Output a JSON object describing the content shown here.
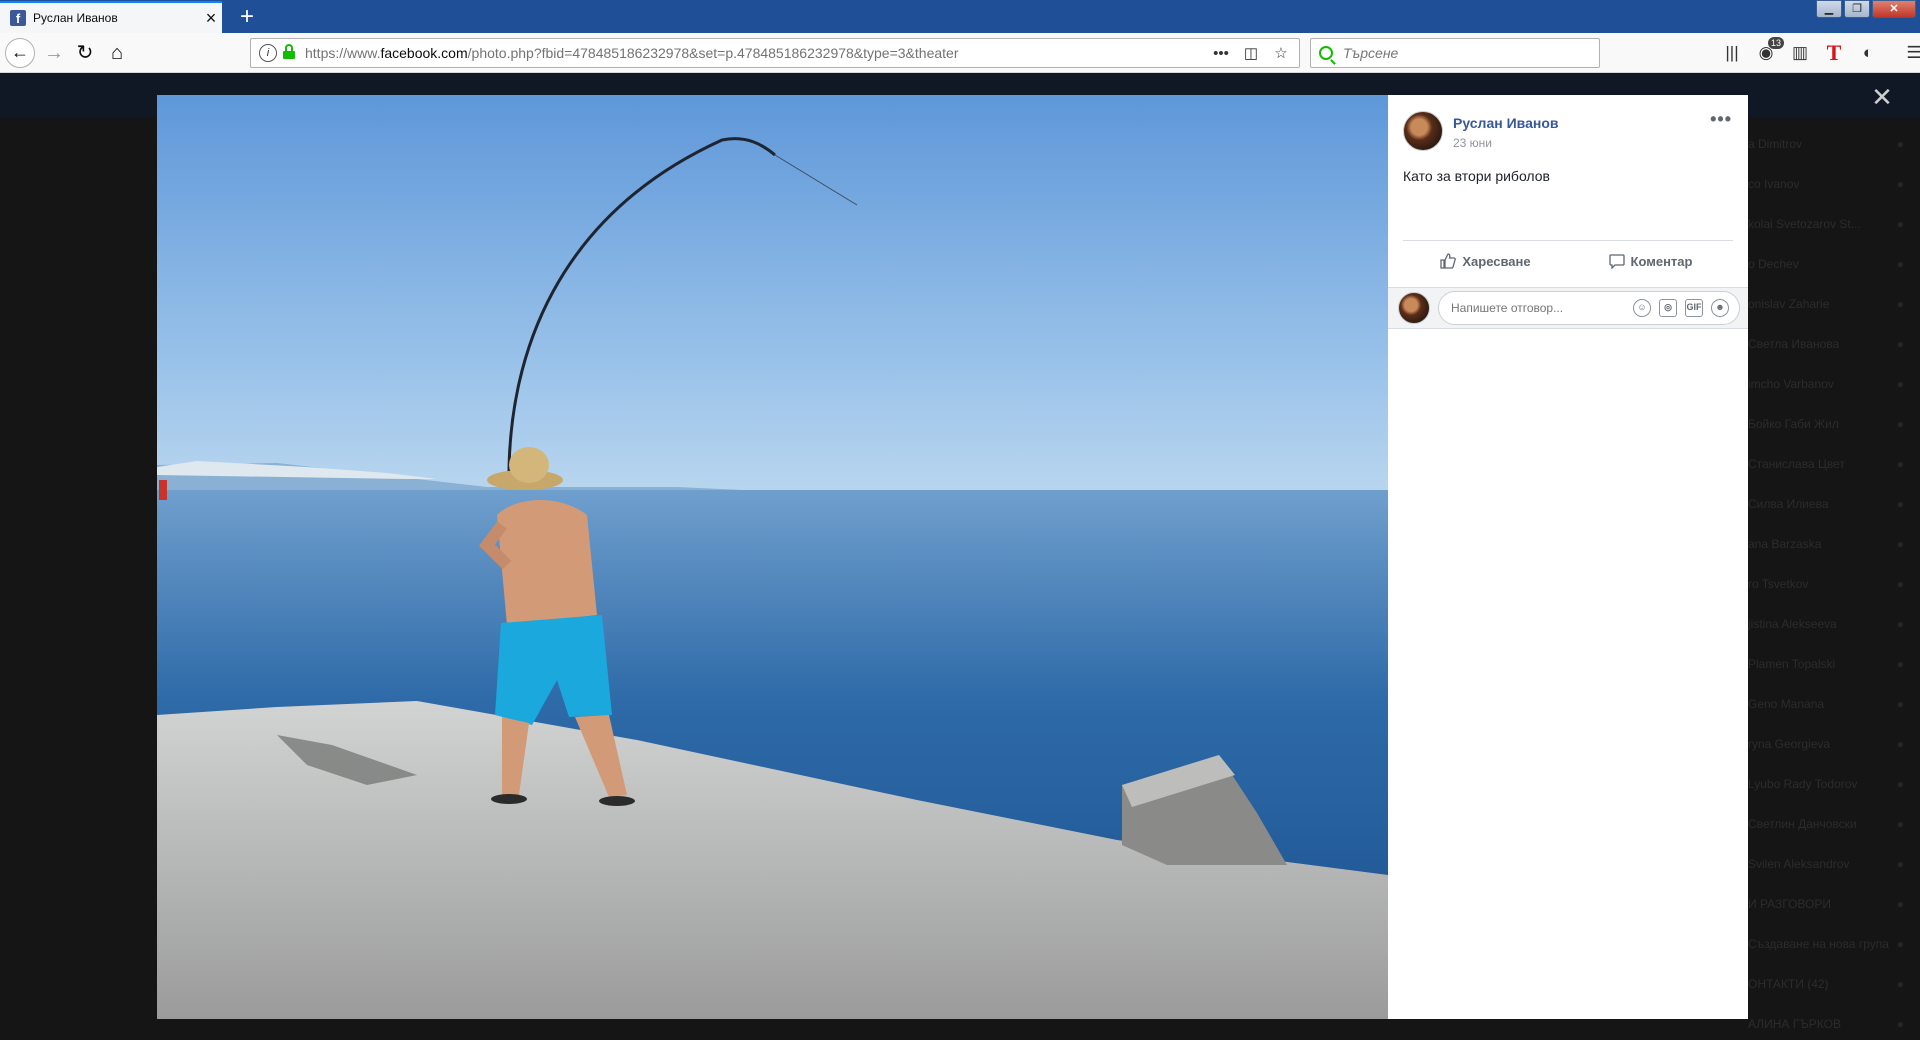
{
  "browser": {
    "tab_title": "Руслан Иванов",
    "tab_favicon": "facebook-favicon",
    "new_tab_label": "+",
    "url_host_prefix": "https://www.",
    "url_host": "facebook.com",
    "url_path": "/photo.php?fbid=478485186232978&set=p.478485186232978&type=3&theater",
    "search_placeholder": "Търсене",
    "notification_count": "13",
    "window_controls": [
      "minimize-icon",
      "maximize-icon",
      "close-icon"
    ]
  },
  "background_chat": {
    "contacts": [
      "a Dimitrov",
      "co Ivanov",
      "kolai Svetozarov St...",
      "o Dechev",
      "onislav Zaharie",
      "Светла Иванова",
      "imcho Varbanov",
      "Бойко Габи Жил",
      "Станислава Цвет",
      "Силва Илиева",
      "ana Barzaska",
      "ro Tsvetkov",
      "jistina Alekseeva",
      "Plamen Topalski",
      "Geno Manana",
      "ryna Georgieva",
      "Lyubo Rady Todorov",
      "Светлин Данчовски",
      "Svilen Aleksandrov",
      "И РАЗГОВОРИ",
      "Създаване на нова група",
      "ОНТАКТИ (42)",
      "АЛИНА ГЪРКОВ"
    ]
  },
  "photo": {
    "subject": "man-fishing-on-pier-photo"
  },
  "post": {
    "author": "Руслан Иванов",
    "date": "23 юни",
    "caption": "Като за втори риболов",
    "more_label": "•••",
    "like_label": "Харесване",
    "comment_label": "Коментар",
    "comment_placeholder": "Напишете отговор...",
    "comment_tools": [
      "emoji-icon",
      "camera-icon",
      "gif-icon",
      "sticker-icon"
    ]
  },
  "colors": {
    "author_link": "#365899",
    "titlebar": "#1f4f97",
    "secure_lock": "#12bc00"
  }
}
